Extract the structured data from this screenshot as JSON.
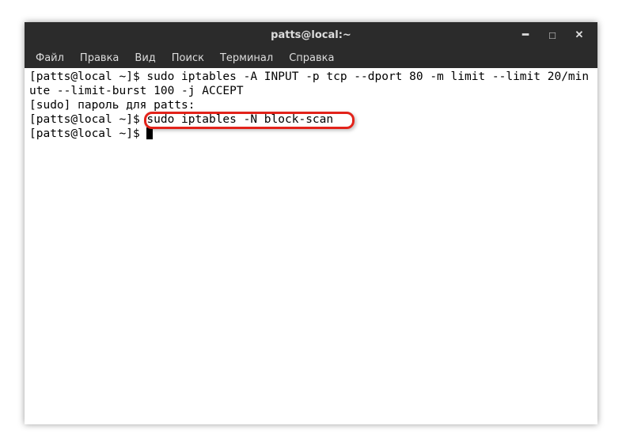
{
  "window": {
    "title": "patts@local:~"
  },
  "controls": {
    "minimize": "━",
    "maximize": "□",
    "close": "✕"
  },
  "menu": {
    "file": "Файл",
    "edit": "Правка",
    "view": "Вид",
    "search": "Поиск",
    "terminal": "Терминал",
    "help": "Справка"
  },
  "terminal": {
    "prompt1": "[patts@local ~]$ ",
    "cmd1": "sudo iptables -A INPUT -p tcp --dport 80 -m limit --limit 20/minute --limit-burst 100 -j ACCEPT",
    "sudo_line": "[sudo] пароль для patts:",
    "prompt2": "[patts@local ~]$ ",
    "cmd2": "sudo iptables -N block-scan",
    "prompt3": "[patts@local ~]$ "
  }
}
